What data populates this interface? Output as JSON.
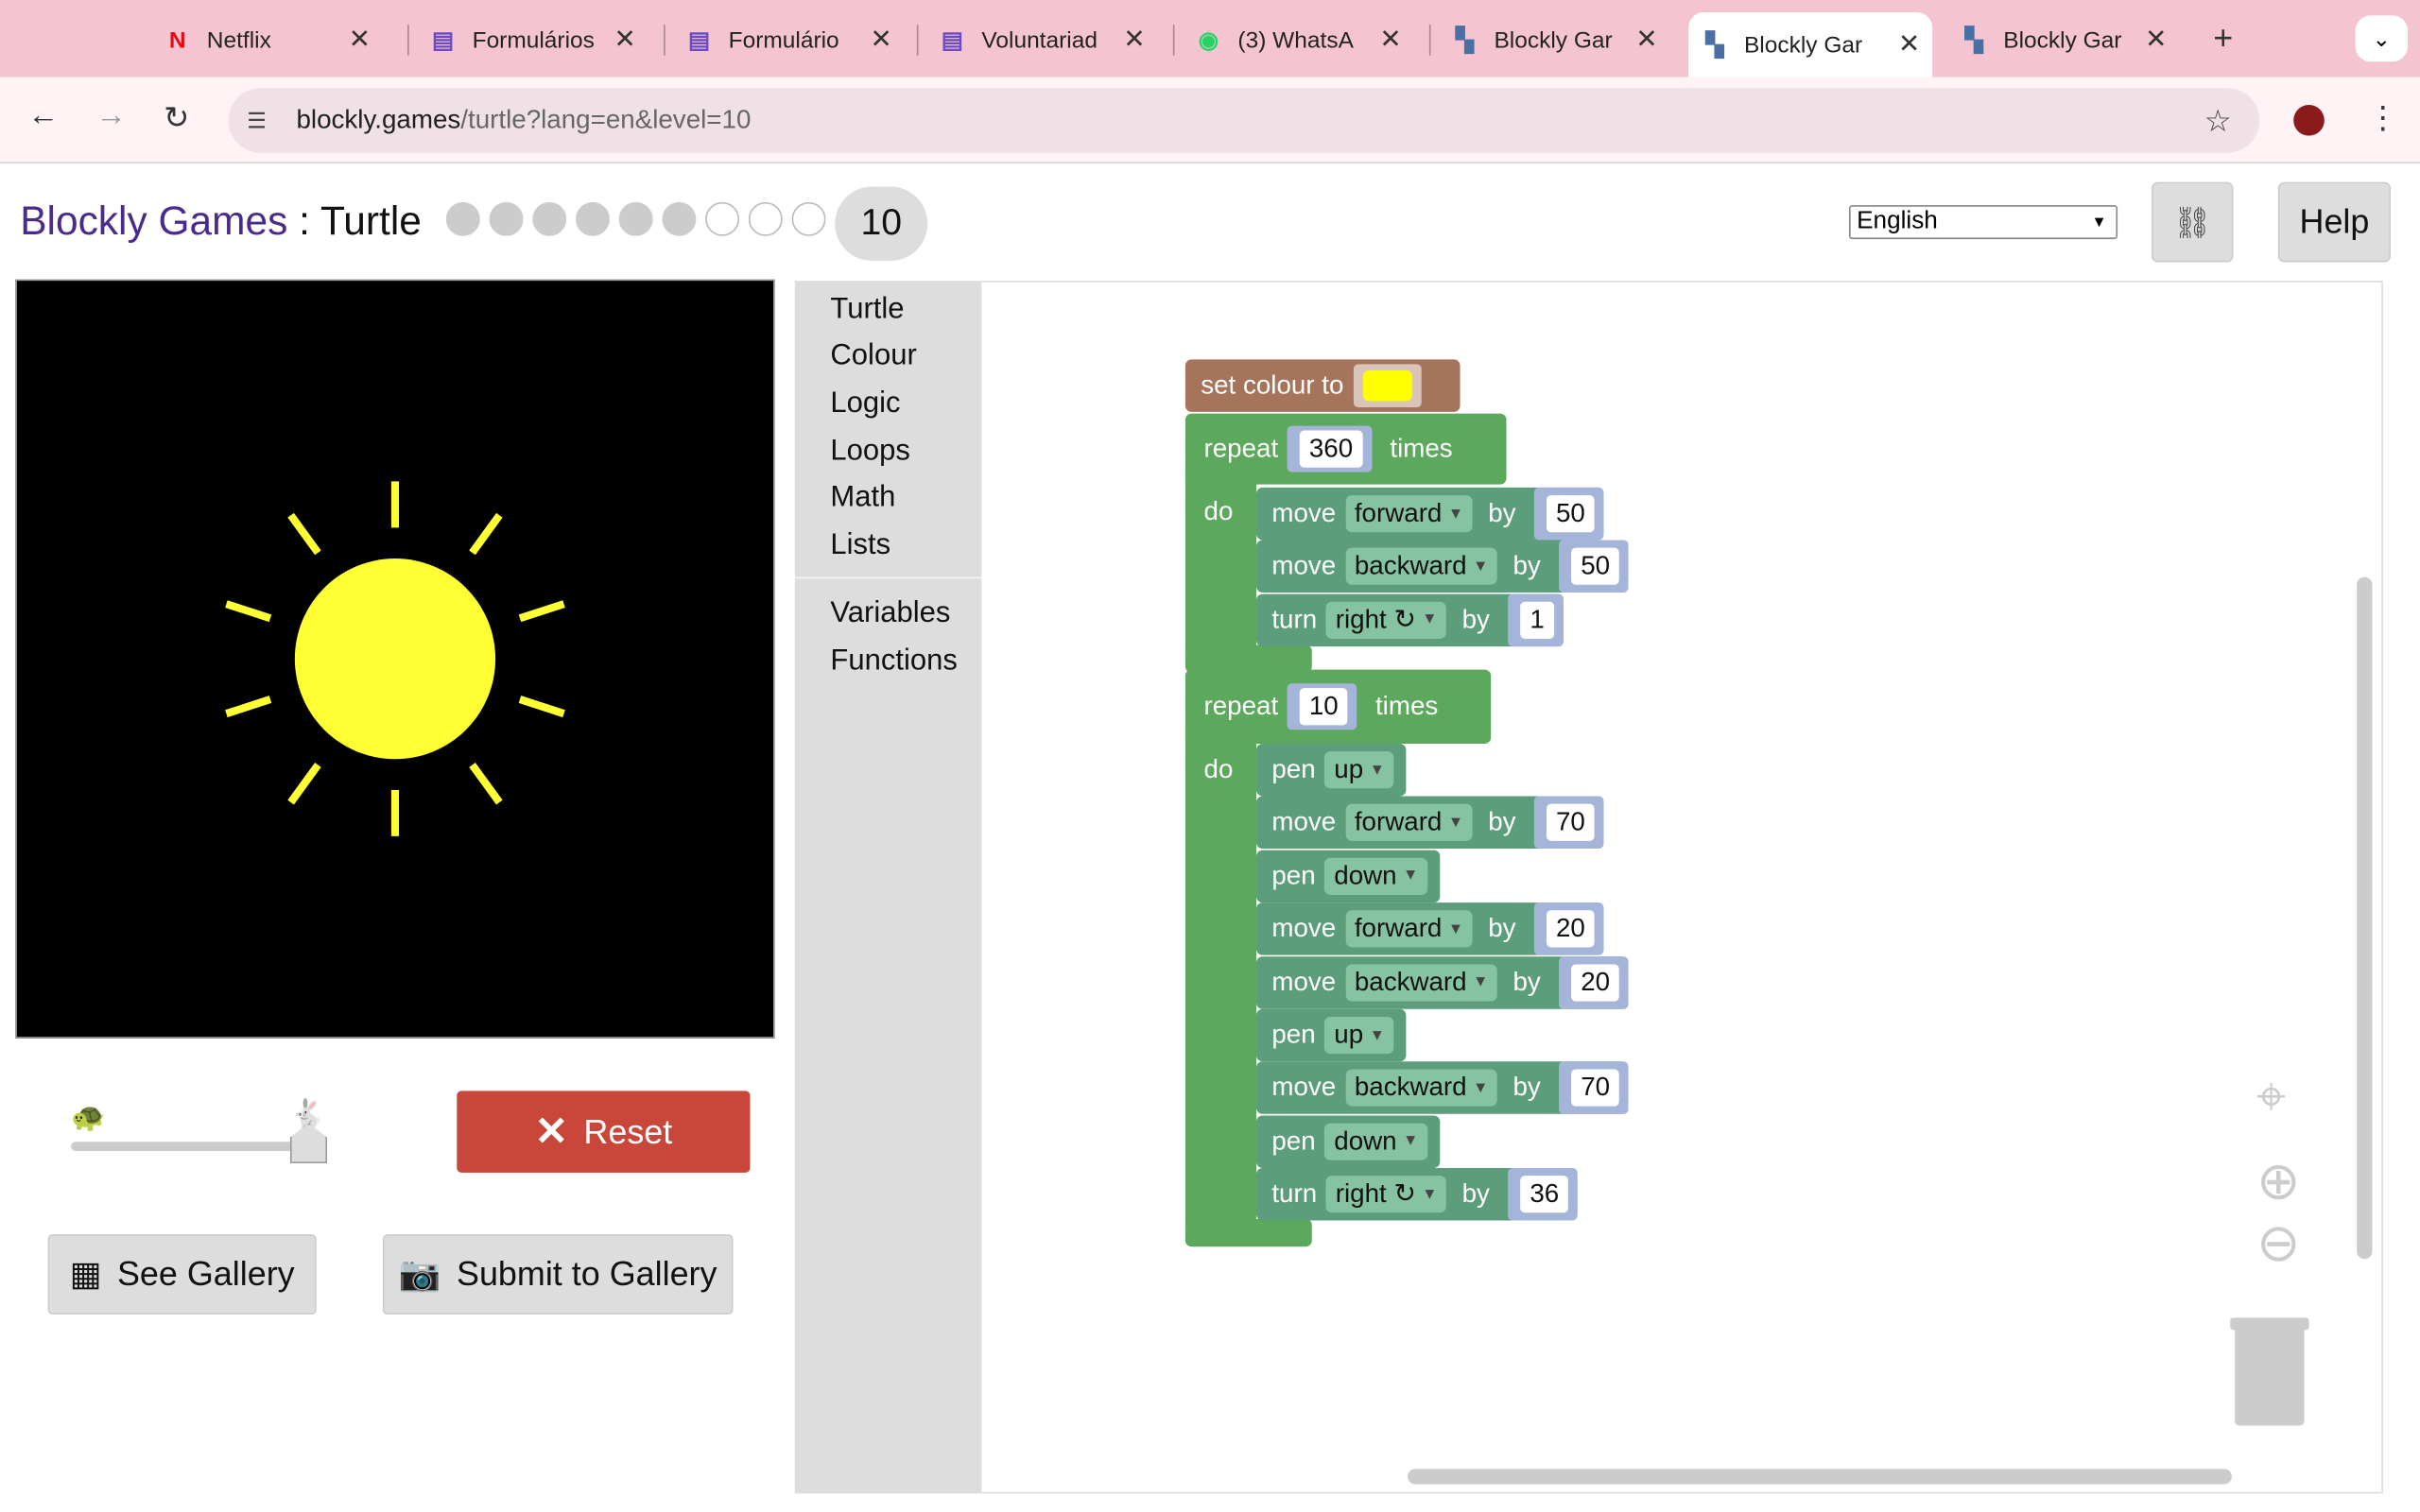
{
  "browser": {
    "tabs": [
      {
        "label": "Netflix",
        "icon": "netflix-icon"
      },
      {
        "label": "Formulários",
        "icon": "docs-icon"
      },
      {
        "label": "Formulário",
        "icon": "forms-icon"
      },
      {
        "label": "Voluntariad",
        "icon": "forms-icon"
      },
      {
        "label": "(3) WhatsA",
        "icon": "whatsapp-icon"
      },
      {
        "label": "Blockly Gar",
        "icon": "blockly-icon"
      },
      {
        "label": "Blockly Gar",
        "icon": "blockly-icon"
      },
      {
        "label": "Blockly Gar",
        "icon": "blockly-icon"
      }
    ],
    "active_tab": 6,
    "url_host": "blockly.games",
    "url_path": "/turtle?lang=en&level=10"
  },
  "page": {
    "brand": "Blockly Games",
    "separator": " : ",
    "game": "Turtle",
    "level": "10",
    "levels_total": 10,
    "levels_done": 6,
    "language": "English",
    "help_label": "Help",
    "reset_label": "Reset",
    "see_gallery_label": "See Gallery",
    "submit_gallery_label": "Submit to Gallery",
    "speed": 1.0
  },
  "toolbox": {
    "categories": [
      "Turtle",
      "Colour",
      "Logic",
      "Loops",
      "Math",
      "Lists"
    ],
    "extra": [
      "Variables",
      "Functions"
    ]
  },
  "blocks": {
    "set_colour": "set colour to",
    "colour_value": "#ffff00",
    "repeat1": {
      "label": "repeat",
      "count": "360",
      "times": "times",
      "do": "do"
    },
    "repeat2": {
      "label": "repeat",
      "count": "10",
      "times": "times",
      "do": "do"
    },
    "inner1": [
      {
        "cmd": "move",
        "opt": "forward",
        "by": "by",
        "val": "50"
      },
      {
        "cmd": "move",
        "opt": "backward",
        "by": "by",
        "val": "50"
      },
      {
        "cmd": "turn",
        "opt": "right ↻",
        "by": "by",
        "val": "1"
      }
    ],
    "inner2": [
      {
        "cmd": "pen",
        "opt": "up"
      },
      {
        "cmd": "move",
        "opt": "forward",
        "by": "by",
        "val": "70"
      },
      {
        "cmd": "pen",
        "opt": "down"
      },
      {
        "cmd": "move",
        "opt": "forward",
        "by": "by",
        "val": "20"
      },
      {
        "cmd": "move",
        "opt": "backward",
        "by": "by",
        "val": "20"
      },
      {
        "cmd": "pen",
        "opt": "up"
      },
      {
        "cmd": "move",
        "opt": "backward",
        "by": "by",
        "val": "70"
      },
      {
        "cmd": "pen",
        "opt": "down"
      },
      {
        "cmd": "turn",
        "opt": "right ↻",
        "by": "by",
        "val": "36"
      }
    ]
  },
  "colors": {
    "brand": "#4a2b8c",
    "reset": "#c9473a",
    "sun": "#ffff33",
    "loop": "#5ca85c",
    "turtle": "#5c9d7c",
    "colour_block": "#a5745b"
  }
}
